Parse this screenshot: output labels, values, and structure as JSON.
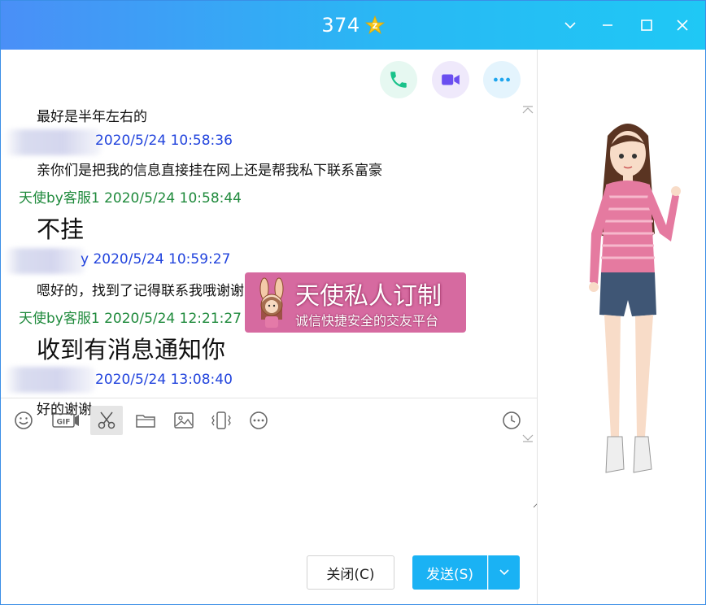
{
  "window": {
    "title": "374"
  },
  "messages": [
    {
      "type": "text",
      "text": "最好是半年左右的"
    },
    {
      "type": "meta",
      "sender": "",
      "time": "2020/5/24 10:58:36",
      "color": "blue"
    },
    {
      "type": "text",
      "text": "亲你们是把我的信息直接挂在网上还是帮我私下联系富豪"
    },
    {
      "type": "meta",
      "sender": "天使by客服1",
      "time": "2020/5/24 10:58:44",
      "color": "green"
    },
    {
      "type": "big",
      "text": "不挂"
    },
    {
      "type": "meta",
      "sender": "y",
      "time": "2020/5/24 10:59:27",
      "color": "blue"
    },
    {
      "type": "text",
      "text": "嗯好的，找到了记得联系我哦谢谢"
    },
    {
      "type": "meta",
      "sender": "天使by客服1",
      "time": "2020/5/24 12:21:27",
      "color": "green"
    },
    {
      "type": "big",
      "text": "收到有消息通知你"
    },
    {
      "type": "meta",
      "sender": "",
      "time": "2020/5/24 13:08:40",
      "color": "blue"
    },
    {
      "type": "text",
      "text": "好的谢谢"
    }
  ],
  "watermark": {
    "title": "天使私人订制",
    "subtitle": "诚信快捷安全的交友平台"
  },
  "buttons": {
    "close": "关闭(C)",
    "send": "发送(S)"
  },
  "colors": {
    "accent": "#1ab2f4",
    "sender_green": "#1f8a3c",
    "sender_blue": "#2244dd"
  }
}
